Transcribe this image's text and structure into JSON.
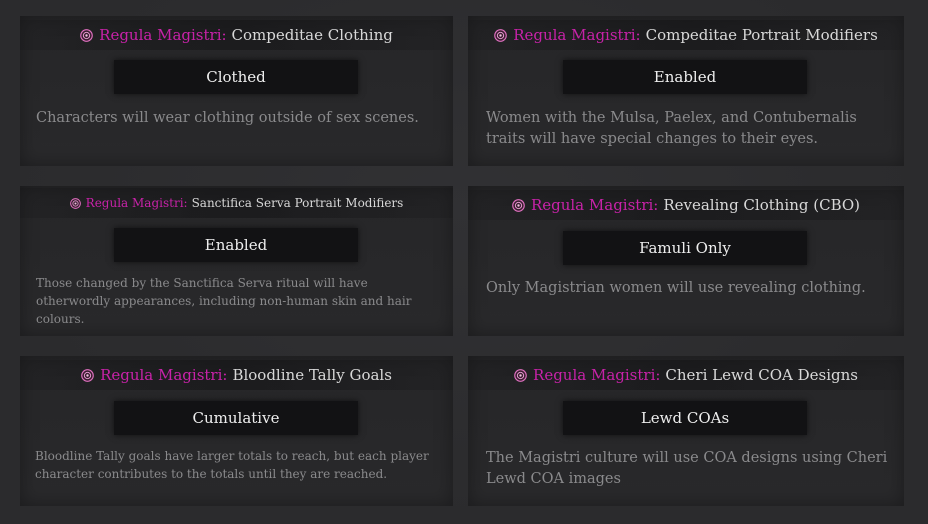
{
  "settings": [
    {
      "prefix": "Regula Magistri:",
      "title": "Compeditae Clothing",
      "value": "Clothed",
      "description": "Characters will wear clothing outside of sex scenes."
    },
    {
      "prefix": "Regula Magistri:",
      "title": "Compeditae Portrait Modifiers",
      "value": "Enabled",
      "description": "Women with the Mulsa, Paelex, and Contubernalis traits will have special changes to their eyes."
    },
    {
      "prefix": "Regula Magistri:",
      "title": "Sanctifica Serva Portrait Modifiers",
      "value": "Enabled",
      "description": "Those changed by the Sanctifica Serva ritual will have otherwordly appearances, including non-human skin and hair colours."
    },
    {
      "prefix": "Regula Magistri:",
      "title": "Revealing Clothing (CBO)",
      "value": "Famuli Only",
      "description": "Only Magistrian women will use revealing clothing."
    },
    {
      "prefix": "Regula Magistri:",
      "title": "Bloodline Tally Goals",
      "value": "Cumulative",
      "description": "Bloodline Tally goals have larger totals to reach, but each player character contributes to the totals until they are reached."
    },
    {
      "prefix": "Regula Magistri:",
      "title": "Cheri Lewd COA Designs",
      "value": "Lewd COAs",
      "description": "The Magistri culture will use COA designs using Cheri Lewd COA images"
    }
  ],
  "icon": "regula-seal-icon",
  "colors": {
    "prefix": "#c722a8",
    "title": "#d8d8d8",
    "value_text": "#eeeeee",
    "description": "#8a8a8c"
  }
}
